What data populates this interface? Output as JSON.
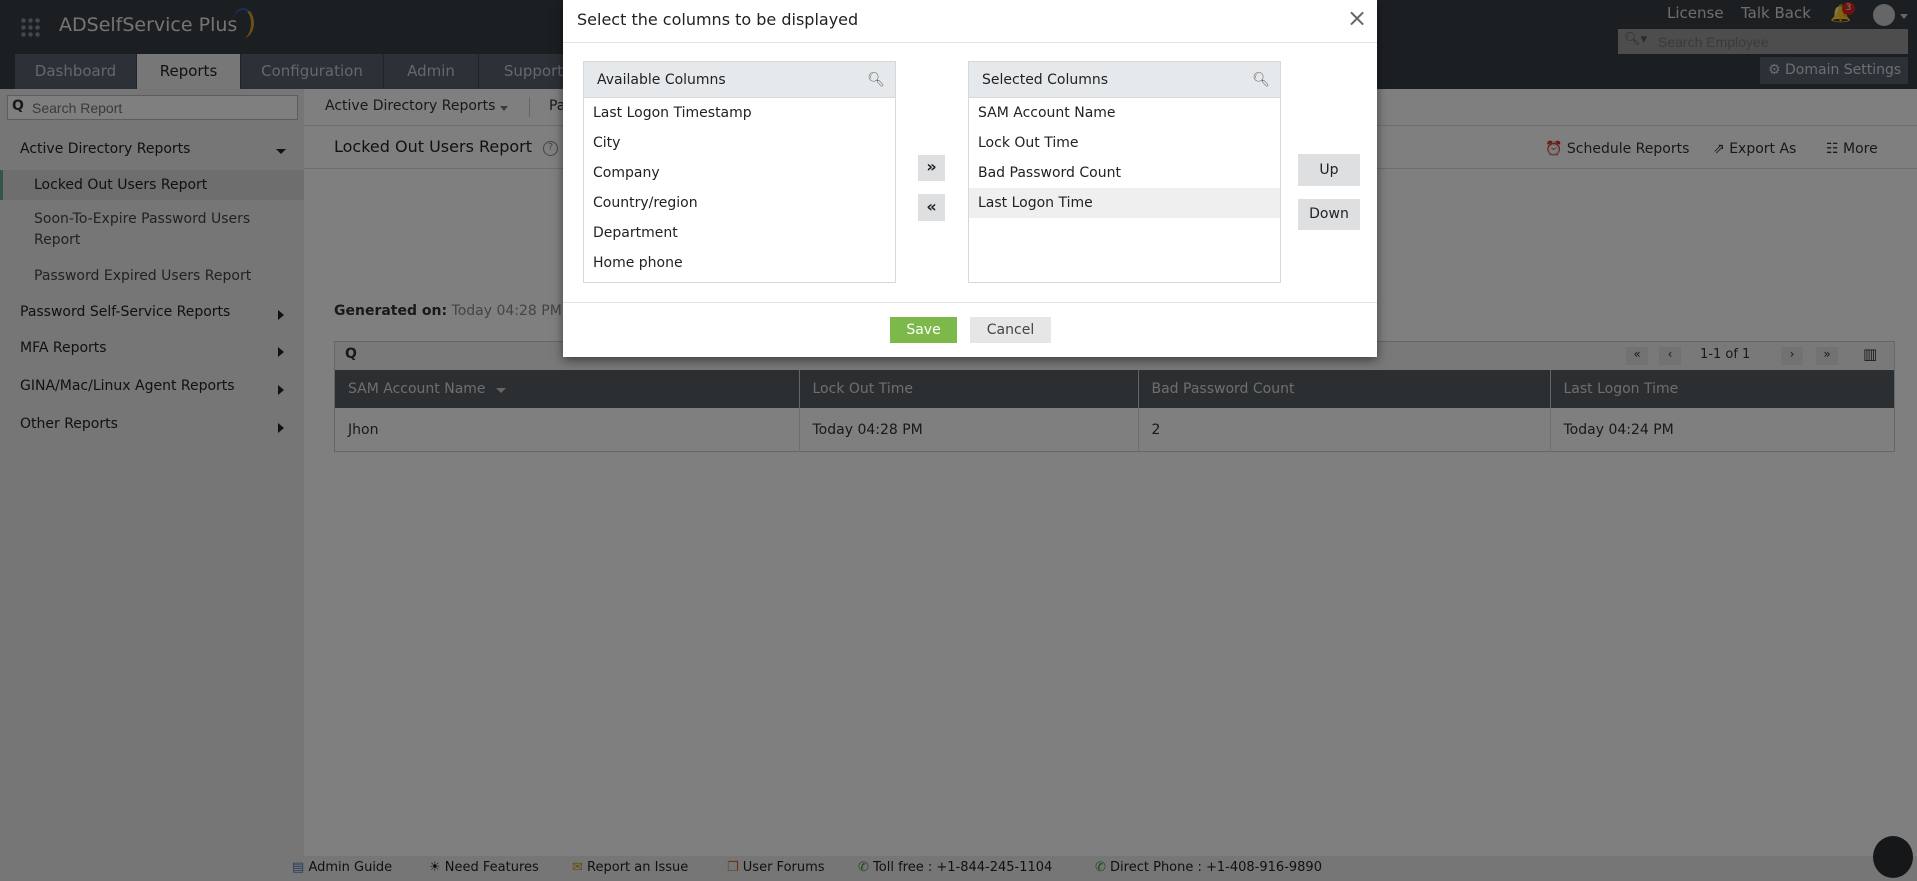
{
  "app": {
    "title": "ADSelfService Plus"
  },
  "header": {
    "license": "License",
    "talk_back": "Talk Back",
    "notification_count": "3",
    "search_employee_placeholder": "Search Employee",
    "domain_settings": "Domain Settings"
  },
  "tabs": [
    {
      "label": "Dashboard"
    },
    {
      "label": "Reports",
      "active": true
    },
    {
      "label": "Configuration"
    },
    {
      "label": "Admin"
    },
    {
      "label": "Support"
    }
  ],
  "sidebar": {
    "search_placeholder": "Search Report",
    "sections": [
      {
        "label": "Active Directory Reports",
        "expanded": true,
        "items": [
          {
            "label": "Locked Out Users Report",
            "active": true
          },
          {
            "label": "Soon-To-Expire Password Users",
            "label2": "Report"
          },
          {
            "label": "Password Expired Users Report"
          }
        ]
      },
      {
        "label": "Password Self-Service Reports"
      },
      {
        "label": "MFA Reports"
      },
      {
        "label": "GINA/Mac/Linux Agent Reports"
      },
      {
        "label": "Other Reports"
      }
    ]
  },
  "breadcrumb": {
    "category": "Active Directory Reports",
    "next": "Pa"
  },
  "report": {
    "title": "Locked Out Users Report",
    "schedule": "Schedule Reports",
    "export": "Export As",
    "more": "More",
    "generated_label": "Generated on:",
    "generated_value": "Today 04:28 PM",
    "pagination": "1-1 of 1",
    "columns": [
      "SAM Account Name",
      "Lock Out Time",
      "Bad Password Count",
      "Last Logon Time"
    ],
    "rows": [
      [
        "Jhon",
        "Today 04:28 PM",
        "2",
        "Today 04:24 PM"
      ]
    ]
  },
  "modal": {
    "title": "Select the columns to be displayed",
    "available_header": "Available Columns",
    "selected_header": "Selected Columns",
    "available": [
      "Last Logon Timestamp",
      "City",
      "Company",
      "Country/region",
      "Department",
      "Home phone"
    ],
    "selected": [
      "SAM Account Name",
      "Lock Out Time",
      "Bad Password Count",
      "Last Logon Time"
    ],
    "selected_highlight": "Last Logon Time",
    "add": "»",
    "remove": "«",
    "up": "Up",
    "down": "Down",
    "save": "Save",
    "cancel": "Cancel",
    "close": "×"
  },
  "footer": {
    "admin_guide": "Admin Guide",
    "need_features": "Need Features",
    "report_issue": "Report an Issue",
    "user_forums": "User Forums",
    "toll_free": "Toll free : +1-844-245-1104",
    "direct_phone": "Direct Phone : +1-408-916-9890"
  },
  "colors": {
    "save": "#7cb94a",
    "header": "#383e44"
  }
}
